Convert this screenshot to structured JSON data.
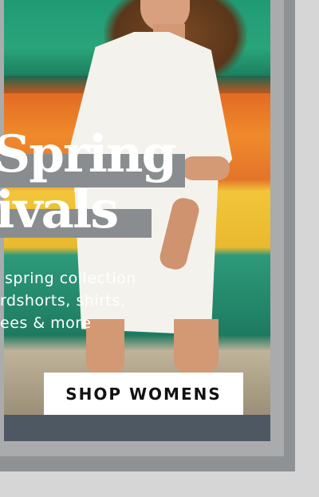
{
  "banner": {
    "headline_line1": "Spring",
    "headline_line2": "ivals",
    "subtext_line1": "spring collection",
    "subtext_line2": "rdshorts, shirts,",
    "subtext_line3": "ees & more",
    "cta_label": "SHOP WOMENS"
  },
  "colors": {
    "cta_background": "#ffffff",
    "cta_text": "#111111",
    "headline_text": "#ffffff",
    "frame": "#8f9294"
  }
}
